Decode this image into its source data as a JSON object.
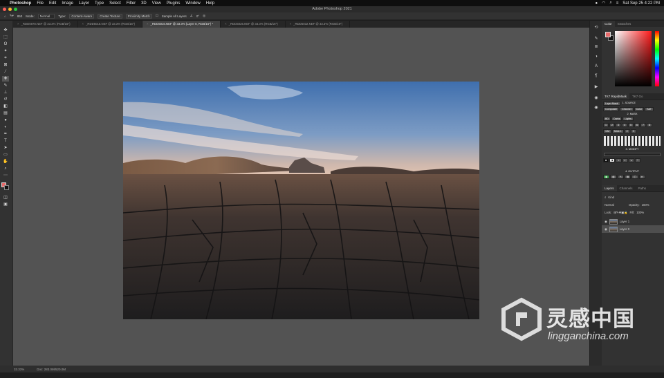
{
  "menubar": {
    "apple": "",
    "app": "Photoshop",
    "items": [
      "File",
      "Edit",
      "Image",
      "Layer",
      "Type",
      "Select",
      "Filter",
      "3D",
      "View",
      "Plugins",
      "Window",
      "Help"
    ],
    "clock": "Sat Sep 25  4:22 PM"
  },
  "window": {
    "title": "Adobe Photoshop 2021"
  },
  "options": {
    "size": "850",
    "mode_label": "Mode:",
    "mode_value": "Normal",
    "type_label": "Type:",
    "content_aware": "Content-Aware",
    "create_texture": "Create Texture",
    "proximity_match": "Proximity Match",
    "sample_all": "Sample All Layers",
    "angle": "0°"
  },
  "tabs": [
    "_RDD5978.NEF @ 33.3% (RGB/16*)",
    "_RDD5015.NEF @ 33.3% (RGB/16*)",
    "_RDD5016.NEF @ 33.3% (Layer 0, RGB/16*) *",
    "_RDD5025.NEF @ 33.3% (RGB/16*)",
    "_RDD5032.NEF @ 33.3% (RGB/16*)"
  ],
  "status": {
    "zoom": "33.33%",
    "doc": "Doc: 283.0M/520.0M"
  },
  "color_panel": {
    "tabs": [
      "Color",
      "Swatches"
    ],
    "fg": "#e86a6a",
    "bg": "#111111"
  },
  "rk_panel": {
    "tabs": [
      "TK7 RapidMask",
      "TK7 Go"
    ],
    "source_header": "1. SOURCE",
    "layer_mask_label": "Layer Mask",
    "source_buttons": [
      "Composite",
      "Channel",
      "Color",
      "SAT"
    ],
    "mask_header": "2. MASK",
    "mask_tabs": [
      "BD",
      "Darks",
      "Lights"
    ],
    "zone_row": [
      "1",
      "2",
      "3",
      "4",
      "5",
      "6",
      "7",
      "8"
    ],
    "mid_buttons": [
      "1/M",
      "Mids 1",
      "2",
      "3"
    ],
    "modify_header": "3. MODIFY",
    "output_header": "4. OUTPUT"
  },
  "layers_panel": {
    "tabs": [
      "Layers",
      "Channels",
      "Paths"
    ],
    "kind": "Kind",
    "blend": "Normal",
    "opacity_label": "Opacity:",
    "opacity": "100%",
    "lock_label": "Lock:",
    "fill_label": "Fill:",
    "fill": "100%",
    "layers": [
      {
        "name": "Layer 1",
        "selected": false
      },
      {
        "name": "Layer 0",
        "selected": true
      }
    ]
  },
  "watermark": {
    "cn": "灵感中国",
    "en": "lingganchina.com"
  }
}
